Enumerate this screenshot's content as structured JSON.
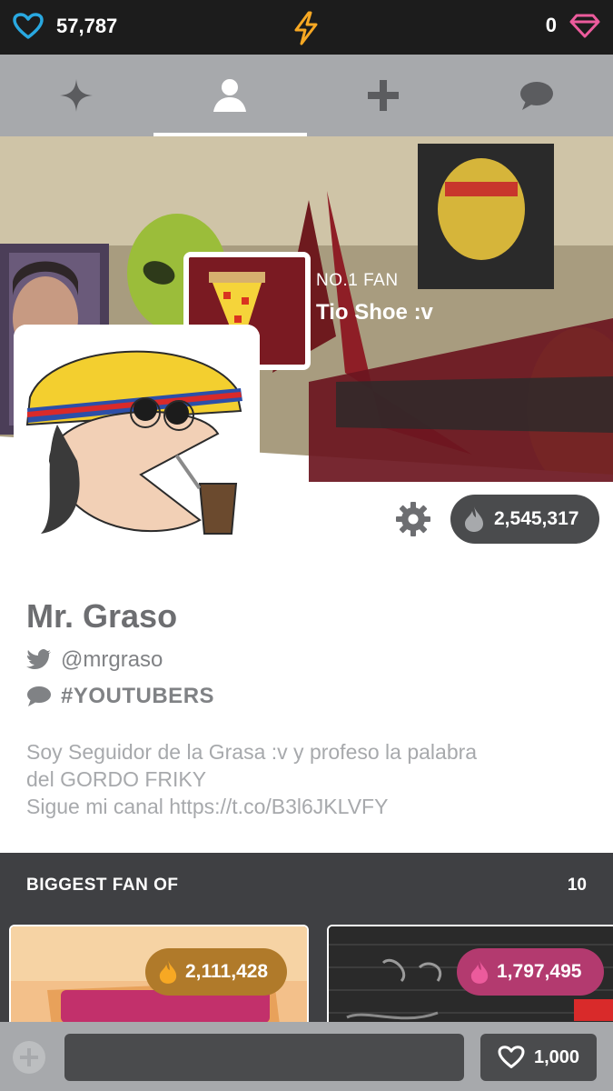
{
  "status": {
    "hearts_count": "57,787",
    "gems_count": "0",
    "colors": {
      "heart": "#29a8e0",
      "bolt": "#f7a823",
      "gem": "#ec5b9c"
    }
  },
  "tabs": [
    {
      "icon": "sparkle-icon",
      "active": false
    },
    {
      "icon": "profile-icon",
      "active": true
    },
    {
      "icon": "plus-icon",
      "active": false
    },
    {
      "icon": "chat-icon",
      "active": false
    }
  ],
  "banner": {
    "fan_label": "NO.1 FAN",
    "fan_name": "Tio Shoe :v"
  },
  "profile": {
    "fire_count": "2,545,317",
    "name": "Mr. Graso",
    "handle": "@mrgraso",
    "category": "#YOUTUBERS",
    "bio_lines": [
      "Soy Seguidor de la Grasa :v y profeso la palabra",
      "del GORDO FRIKY",
      "Sigue mi canal https://t.co/B3l6JKLVFY"
    ]
  },
  "biggest_fan": {
    "title": "BIGGEST FAN OF",
    "count": "10",
    "cards": [
      {
        "value": "2,111,428",
        "pill_color": "#b07a2a"
      },
      {
        "value": "1,797,495",
        "pill_color": "#b33a6f"
      }
    ]
  },
  "bottom": {
    "comment_placeholder": "",
    "like_count": "1,000"
  }
}
